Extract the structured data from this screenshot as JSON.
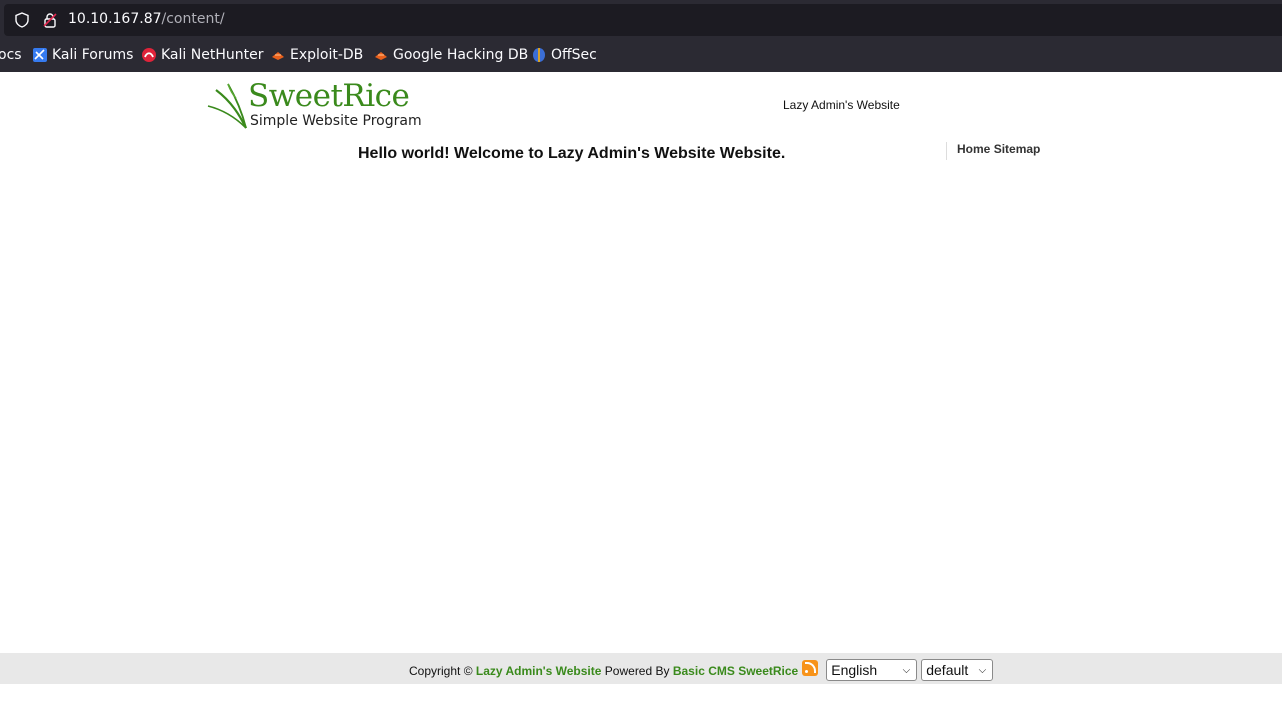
{
  "browser": {
    "url_host": "10.10.167.87",
    "url_path": "/content/",
    "bookmarks": [
      {
        "label": "ocs",
        "icon": "docs-icon"
      },
      {
        "label": "Kali Forums",
        "icon": "kali-forums-icon"
      },
      {
        "label": "Kali NetHunter",
        "icon": "kali-nethunter-icon"
      },
      {
        "label": "Exploit-DB",
        "icon": "exploit-db-icon"
      },
      {
        "label": "Google Hacking DB",
        "icon": "google-hacking-db-icon"
      },
      {
        "label": "OffSec",
        "icon": "offsec-icon"
      }
    ]
  },
  "site": {
    "logo_title": "SweetRice",
    "logo_subtitle": "Simple Website Program",
    "title": "Lazy Admin's Website",
    "welcome": "Hello world! Welcome to Lazy Admin's Website Website.",
    "nav": [
      "Home",
      "Sitemap"
    ]
  },
  "footer": {
    "copyright_prefix": "Copyright ©",
    "site_link": "Lazy Admin's Website",
    "powered_by": "Powered By",
    "cms_link": "Basic CMS SweetRice",
    "language": "English",
    "theme": "default"
  },
  "colors": {
    "brand_green": "#3a8a1c",
    "chrome_bg": "#2b2a33",
    "urlbar_bg": "#1c1b22"
  }
}
